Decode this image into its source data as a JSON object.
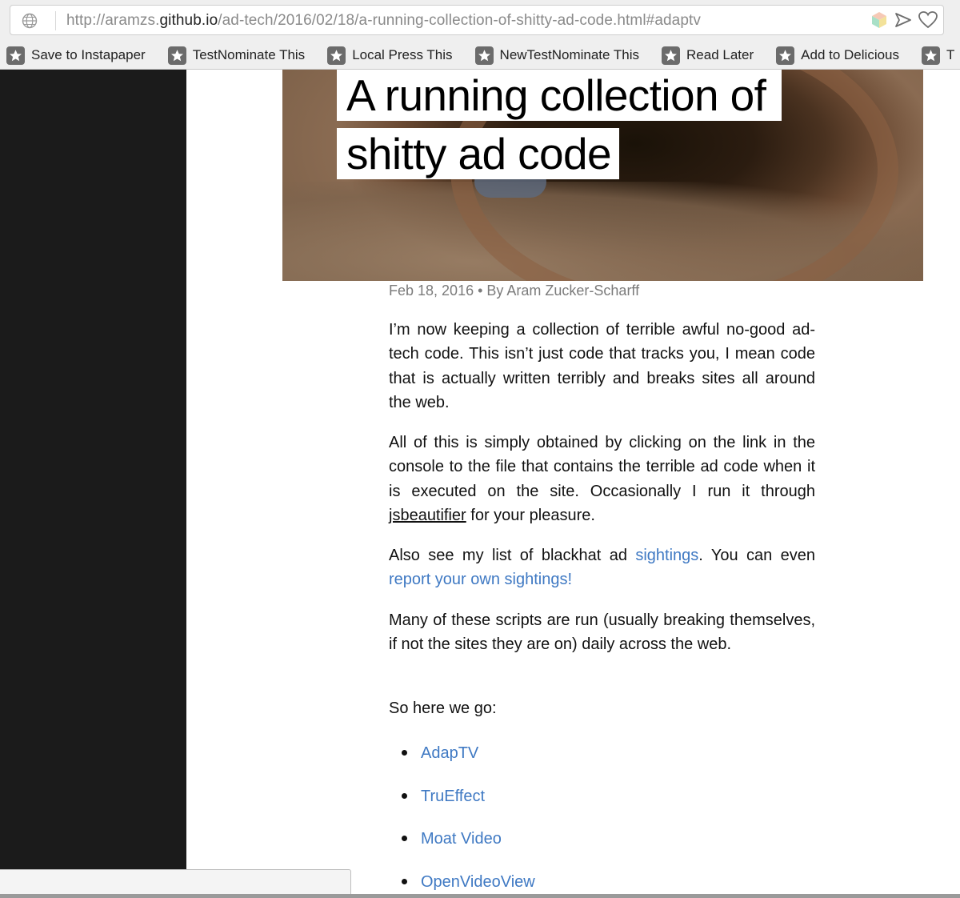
{
  "browser": {
    "url_prefix": "http://aramzs.",
    "url_host": "github.io",
    "url_path": "/ad-tech/2016/02/18/a-running-collection-of-shitty-ad-code.html#adaptv",
    "icons": [
      "globe-icon",
      "cube-icon",
      "send-icon",
      "heart-icon"
    ],
    "bookmarks": [
      {
        "label": "Save to Instapaper"
      },
      {
        "label": "TestNominate This"
      },
      {
        "label": "Local Press This"
      },
      {
        "label": "NewTestNominate This"
      },
      {
        "label": "Read Later"
      },
      {
        "label": "Add to Delicious"
      },
      {
        "label": "T"
      }
    ]
  },
  "article": {
    "title_line_1": "A running collection of",
    "title_line_2": "shitty ad code",
    "meta": "Feb 18, 2016 • By Aram Zucker-Scharff",
    "p1": "I’m now keeping a collection of terrible awful no-good ad-tech code. This isn’t just code that tracks you, I mean code that is actually written terribly and breaks sites all around the web.",
    "p2_before": "All of this is simply obtained by clicking on the link in the console to the file that contains the terrible ad code when it is executed on the site. Occasionally I run it through ",
    "p2_link": "jsbeautifier",
    "p2_after": " for your pleasure.",
    "p3_before": "Also see my list of blackhat ad ",
    "p3_link1": "sightings",
    "p3_middle": ". You can even ",
    "p3_link2": "report your own sightings!",
    "p4": "Many of these scripts are run (usually breaking themselves, if not the sites they are on) daily across the web.",
    "p5": "So here we go:",
    "toc": [
      "AdapTV",
      "TruEffect",
      "Moat Video",
      "OpenVideoView"
    ]
  },
  "colors": {
    "link": "#3f79c3",
    "sidebar": "#1b1b1b",
    "meta_text": "#7b7b7b"
  }
}
